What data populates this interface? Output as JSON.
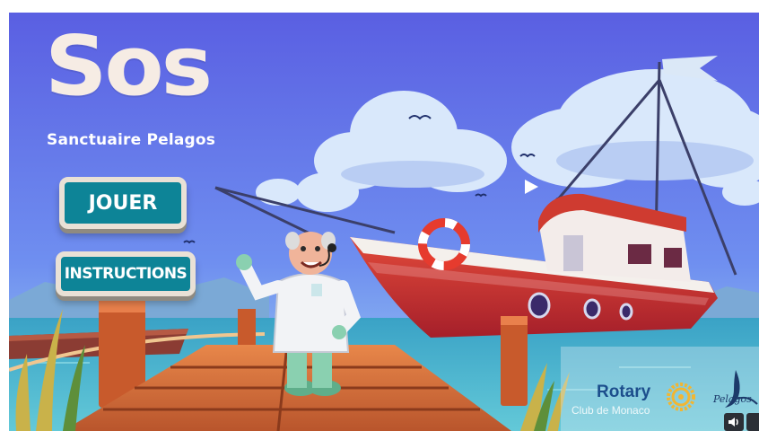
{
  "game": {
    "title": "Sos",
    "subtitle": "Sanctuaire Pelagos"
  },
  "menu": {
    "play_label": "JOUER",
    "instructions_label": "INSTRUCTIONS"
  },
  "partners": {
    "rotary": "Rotary",
    "club": "Club de Monaco",
    "pelagos": "Pelagos"
  },
  "controls": {
    "sound_icon": "speaker-icon",
    "fullscreen_icon": "fullscreen-icon"
  },
  "colors": {
    "sky": "#5f6fe6",
    "button": "#0d8497",
    "boat_hull": "#d7342a",
    "sea": "#3ea9c8"
  }
}
